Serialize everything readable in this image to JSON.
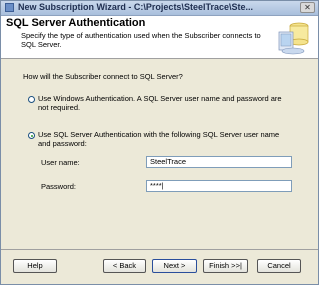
{
  "window": {
    "title": "New Subscription Wizard - C:\\Projects\\SteelTrace\\Ste...",
    "close_label": "✕"
  },
  "header": {
    "title": "SQL Server Authentication",
    "subtitle": "Specify the type of authentication used when the Subscriber connects to SQL Server."
  },
  "body": {
    "question": "How will the Subscriber connect to SQL Server?",
    "options": [
      {
        "label": "Use Windows Authentication. A SQL Server user name and password are not required.",
        "selected": false
      },
      {
        "label": "Use SQL Server Authentication with the following SQL Server user name and password:",
        "selected": true
      }
    ],
    "username_label": "User name:",
    "username_value": "SteelTrace",
    "password_label": "Password:",
    "password_value": "****|"
  },
  "buttons": {
    "help": "Help",
    "back": "< Back",
    "next": "Next >",
    "finish": "Finish >>|",
    "cancel": "Cancel"
  },
  "colors": {
    "window_background": "#ece9d8",
    "radio_selected": "#2f9b2f",
    "title_bar": "#a9bfdc"
  }
}
